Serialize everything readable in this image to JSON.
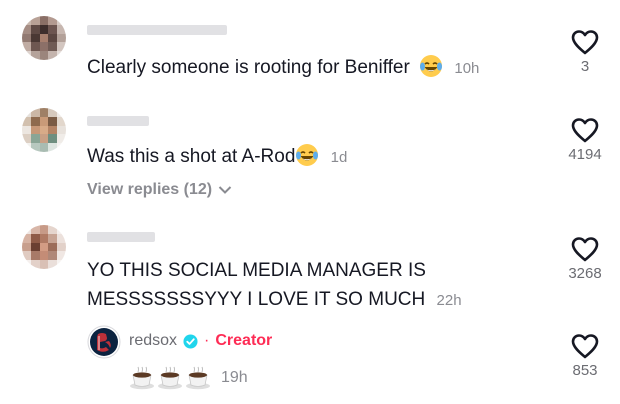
{
  "comments": [
    {
      "text": "Clearly someone is rooting for Beniffer",
      "emoji": "face-with-tears-of-joy",
      "time": "10h",
      "likes": "3"
    },
    {
      "text": "Was this a shot at A-Rod",
      "emoji": "face-with-tears-of-joy",
      "time": "1d",
      "likes": "4194",
      "view_replies": "View replies (12)"
    },
    {
      "text_line1": "YO THIS SOCIAL MEDIA MANAGER IS",
      "text_line2": "MESSSSSSSYYY I LOVE IT SO MUCH",
      "time": "22h",
      "likes": "3268"
    }
  ],
  "reply": {
    "username": "redsox",
    "separator": "·",
    "badge": "Creator",
    "emoji": "hot-beverage",
    "time": "19h",
    "likes": "853"
  },
  "colors": {
    "creator": "#fe2c55",
    "verified": "#20d5ec",
    "text": "#161823",
    "muted": "#8a8b91"
  }
}
